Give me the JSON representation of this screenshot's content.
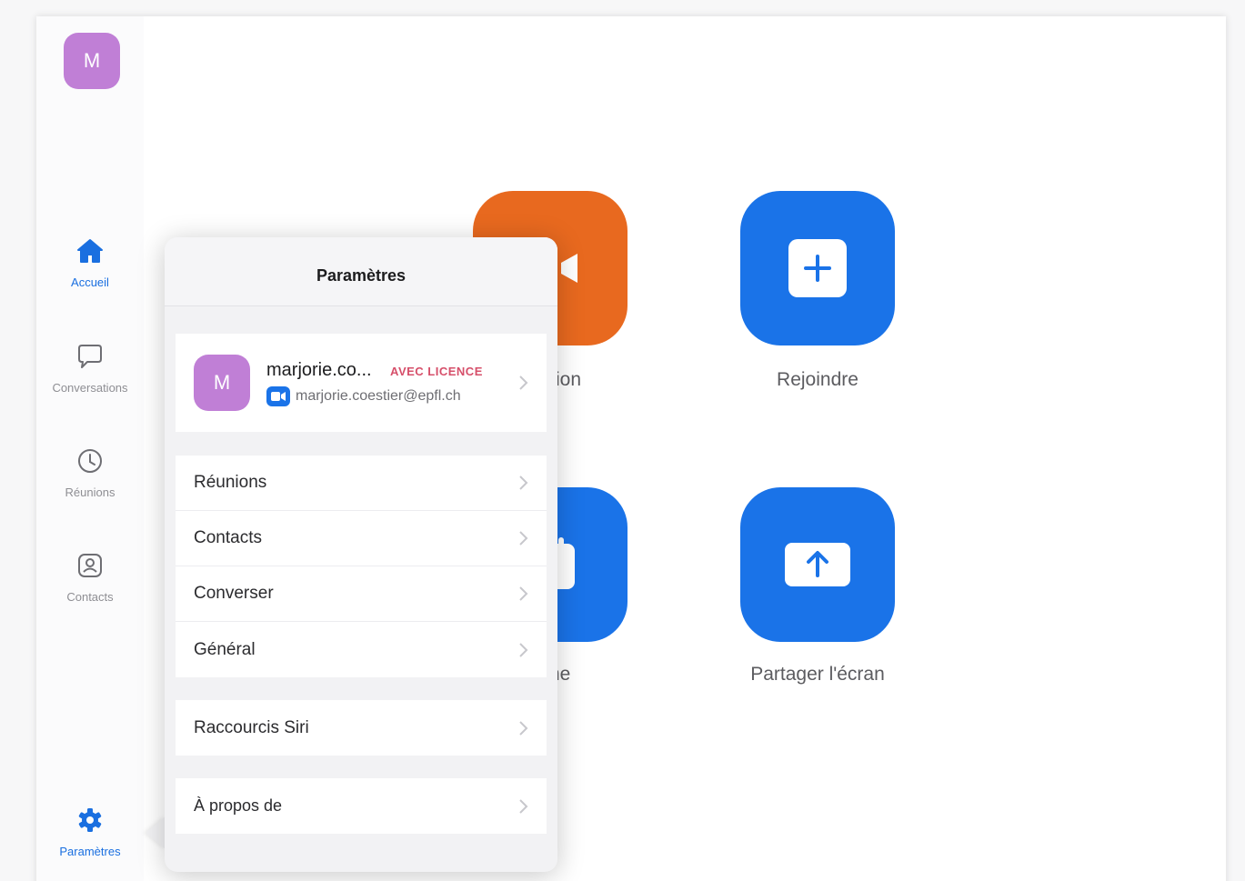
{
  "user": {
    "initial": "M"
  },
  "sidebar": {
    "items": [
      {
        "label": "Accueil",
        "icon": "home-icon",
        "active": true
      },
      {
        "label": "Conversations",
        "icon": "chat-bubble-icon",
        "active": false
      },
      {
        "label": "Réunions",
        "icon": "clock-icon",
        "active": false
      },
      {
        "label": "Contacts",
        "icon": "contact-card-icon",
        "active": false
      },
      {
        "label": "Paramètres",
        "icon": "gear-icon",
        "active": true
      }
    ]
  },
  "tiles": {
    "new_meeting_label": "réunion",
    "join_label": "Rejoindre",
    "schedule_label": "mme",
    "share_label": "Partager l'écran"
  },
  "settings": {
    "title": "Paramètres",
    "profile": {
      "initial": "M",
      "name": "marjorie.co...",
      "badge": "AVEC LICENCE",
      "email": "marjorie.coestier@epfl.ch"
    },
    "menu": [
      "Réunions",
      "Contacts",
      "Converser",
      "Général"
    ],
    "siri": "Raccourcis Siri",
    "about": "À propos de"
  },
  "colors": {
    "accent_blue": "#1a73e8",
    "orange": "#e8691f",
    "avatar_purple": "#c07fd6",
    "badge_red": "#d64f6a"
  }
}
